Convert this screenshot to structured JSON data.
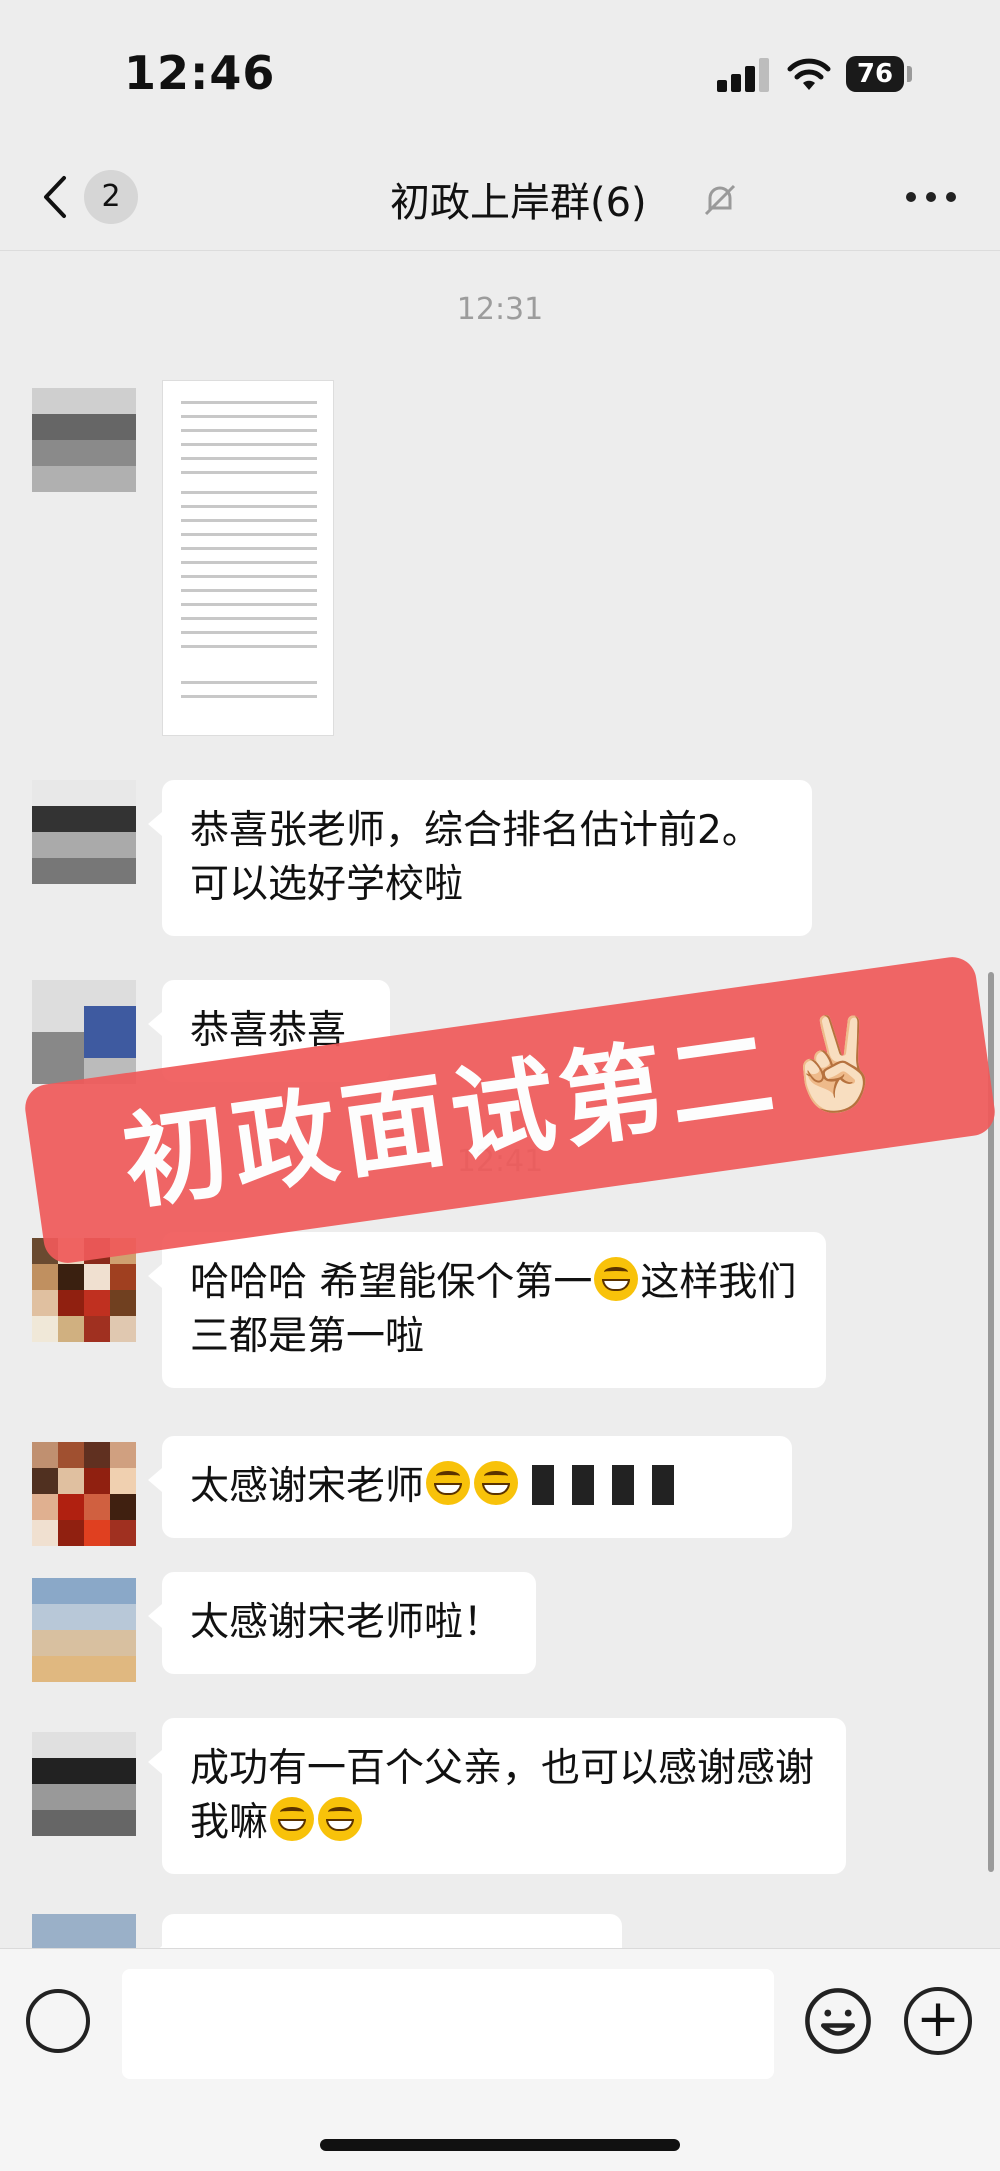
{
  "status_bar": {
    "time": "12:46",
    "battery": "76"
  },
  "header": {
    "unread_count": "2",
    "title": "初政上岸群(6)"
  },
  "chat": {
    "timestamp_1": "12:31",
    "timestamp_2": "12:41",
    "messages": [
      {
        "text": "恭喜张老师，综合排名估计前2。可以选好学校啦"
      },
      {
        "text": "恭喜恭喜"
      },
      {
        "text_before": "哈哈哈 希望能保个第一",
        "text_after": "这样我们三都是第一啦"
      },
      {
        "text": "太感谢宋老师"
      },
      {
        "text": "太感谢宋老师啦！"
      },
      {
        "text_before": "成功有一百个父亲，也可以感谢感谢我嘛"
      }
    ]
  },
  "overlay": {
    "text": "初政面试第二",
    "emoji": "✌🏻"
  },
  "input_bar": {
    "placeholder": ""
  },
  "colors": {
    "background": "#ededed",
    "banner": "#f05a5a",
    "bubble": "#ffffff"
  },
  "icons": [
    "back-chevron-icon",
    "mute-bell-icon",
    "more-dots-icon",
    "voice-icon",
    "emoji-icon",
    "plus-icon"
  ]
}
